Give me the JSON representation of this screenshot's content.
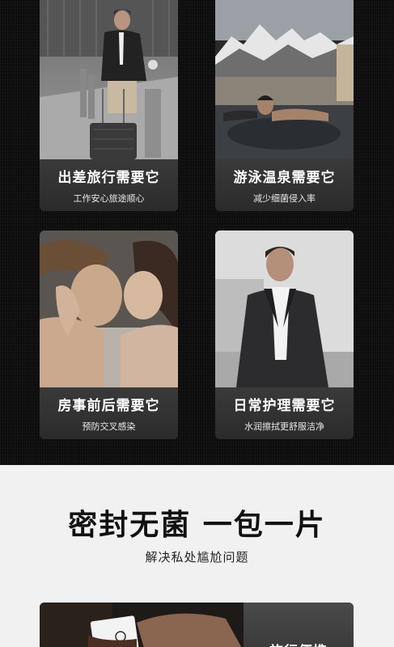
{
  "cards": [
    {
      "title": "出差旅行需要它",
      "subtitle": "工作安心旅途顺心"
    },
    {
      "title": "游泳温泉需要它",
      "subtitle": "减少细菌侵入率"
    },
    {
      "title": "房事前后需要它",
      "subtitle": "预防交叉感染"
    },
    {
      "title": "日常护理需要它",
      "subtitle": "水润擦拭更舒服洁净"
    }
  ],
  "section": {
    "headline": "密封无菌 一包一片",
    "subline": "解决私处尴尬问题"
  },
  "bottom_card": {
    "title": "旅行便携"
  }
}
